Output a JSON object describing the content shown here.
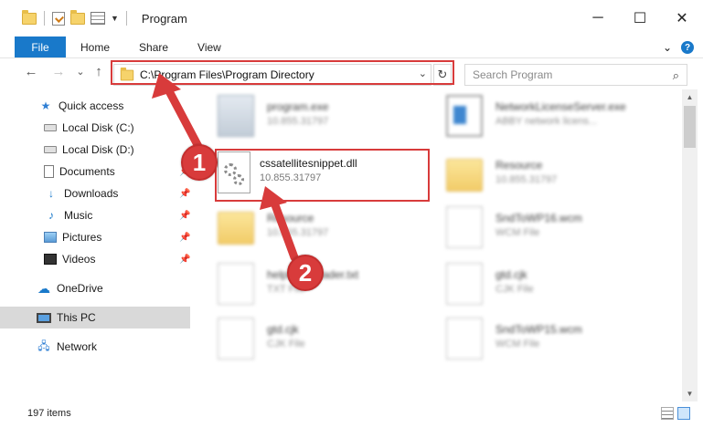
{
  "window": {
    "title": "Program",
    "minimize_glyph": "─",
    "maximize_glyph": "☐",
    "close_glyph": "✕"
  },
  "ribbon": {
    "tabs": [
      "File",
      "Home",
      "Share",
      "View"
    ],
    "collapse_glyph": "⌄",
    "help_glyph": "?"
  },
  "nav": {
    "back_glyph": "←",
    "forward_glyph": "→",
    "recent_glyph": "⌄",
    "up_glyph": "↑",
    "address": "C:\\Program Files\\Program Directory",
    "address_dropdown_glyph": "⌄",
    "refresh_glyph": "↻",
    "search_placeholder": "Search Program",
    "search_glyph": "⌕"
  },
  "sidebar": {
    "items": [
      {
        "label": "Quick access",
        "icon": "star-icon"
      },
      {
        "label": "Local Disk (C:)",
        "icon": "drive-icon"
      },
      {
        "label": "Local Disk (D:)",
        "icon": "drive-icon"
      },
      {
        "label": "Documents",
        "icon": "document-icon"
      },
      {
        "label": "Downloads",
        "icon": "download-icon"
      },
      {
        "label": "Music",
        "icon": "music-icon"
      },
      {
        "label": "Pictures",
        "icon": "pictures-icon"
      },
      {
        "label": "Videos",
        "icon": "videos-icon"
      },
      {
        "label": "OneDrive",
        "icon": "cloud-icon"
      },
      {
        "label": "This PC",
        "icon": "computer-icon"
      },
      {
        "label": "Network",
        "icon": "network-icon"
      }
    ],
    "pin_glyph": "📌",
    "selected": "This PC"
  },
  "files": {
    "highlighted": {
      "name": "cssatellitesnippet.dll",
      "sub": "10.855.31797"
    },
    "others": [
      {
        "name": "program.exe",
        "sub": "10.855.31797"
      },
      {
        "name": "NetworkLicenseServer.exe",
        "sub": "ABBY network licens..."
      },
      {
        "name": "Resource",
        "sub": "10.855.31797"
      },
      {
        "name": "Resource",
        "sub": "10.855.31797"
      },
      {
        "name": "SndToWP16.wcm",
        "sub": "WCM File"
      },
      {
        "name": "helpdownloader.txt",
        "sub": "TXT File"
      },
      {
        "name": "gtd.cjk",
        "sub": "CJK File"
      },
      {
        "name": "gtd.cjk",
        "sub": "CJK File"
      },
      {
        "name": "SndToWP15.wcm",
        "sub": "WCM File"
      }
    ]
  },
  "status": {
    "item_count": "197 items"
  },
  "annotations": {
    "step1": "1",
    "step2": "2",
    "accent": "#d83b3b"
  },
  "colors": {
    "file_tab": "#1979ca",
    "selected_sidebar": "#d9d9d9"
  }
}
